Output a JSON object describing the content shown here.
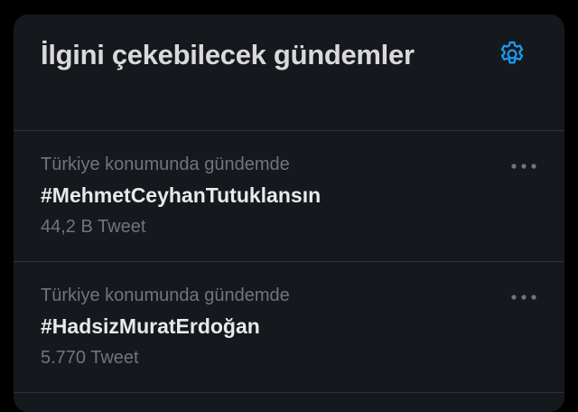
{
  "panel": {
    "title": "İlgini çekebilecek gündemler",
    "settings_icon": "gear-icon",
    "accent_color": "#1d9bf0"
  },
  "trends": [
    {
      "context": "Türkiye konumunda gündemde",
      "name": "#MehmetCeyhanTutuklansın",
      "count": "44,2 B Tweet",
      "more_icon": "more-horizontal-icon"
    },
    {
      "context": "Türkiye konumunda gündemde",
      "name": "#HadsizMuratErdoğan",
      "count": "5.770 Tweet",
      "more_icon": "more-horizontal-icon"
    }
  ]
}
